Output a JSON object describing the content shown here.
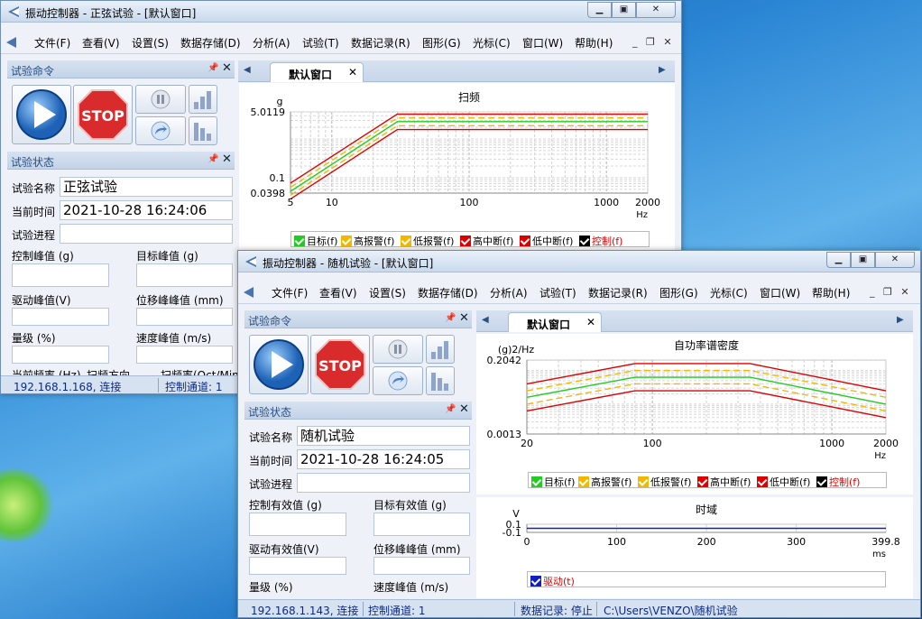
{
  "win1": {
    "title": "振动控制器 - 正弦试验 - [默认窗口]",
    "menu": [
      "文件(F)",
      "查看(V)",
      "设置(S)",
      "数据存储(D)",
      "分析(A)",
      "试验(T)",
      "数据记录(R)",
      "图形(G)",
      "光标(C)",
      "窗口(W)",
      "帮助(H)"
    ],
    "cmd_panel": "试验命令",
    "state_panel": "试验状态",
    "labels": {
      "name": "试验名称",
      "time": "当前时间",
      "progress": "试验进程",
      "ctrl_peak": "控制峰值 (g)",
      "target_peak": "目标峰值 (g)",
      "drive_peak": "驱动峰值(V)",
      "disp_peak": "位移峰峰值 (mm)",
      "level": "量级 (%)",
      "vel_peak": "速度峰值 (m/s)",
      "cut1": "当前频率 (Hz)",
      "cut2": "扫频方向",
      "cut3": "扫频率(Oct/Min)"
    },
    "values": {
      "name": "正弦试验",
      "time": "2021-10-28 16:24:06"
    },
    "tab": "默认窗口",
    "status": {
      "ip": "192.168.1.168, 连接",
      "channel": "控制通道: 1"
    },
    "stop_label": "STOP"
  },
  "win2": {
    "title": "振动控制器 - 随机试验 - [默认窗口]",
    "menu": [
      "文件(F)",
      "查看(V)",
      "设置(S)",
      "数据存储(D)",
      "分析(A)",
      "试验(T)",
      "数据记录(R)",
      "图形(G)",
      "光标(C)",
      "窗口(W)",
      "帮助(H)"
    ],
    "cmd_panel": "试验命令",
    "state_panel": "试验状态",
    "labels": {
      "name": "试验名称",
      "time": "当前时间",
      "progress": "试验进程",
      "ctrl_rms": "控制有效值 (g)",
      "target_rms": "目标有效值 (g)",
      "drive_rms": "驱动有效值(V)",
      "disp_peak": "位移峰峰值 (mm)",
      "level": "量级 (%)",
      "vel_peak": "速度峰值 (m/s)"
    },
    "values": {
      "name": "随机试验",
      "time": "2021-10-28 16:24:05"
    },
    "tab": "默认窗口",
    "status": {
      "ip": "192.168.1.143, 连接",
      "channel": "控制通道: 1",
      "record": "数据记录: 停止",
      "path": "C:\\Users\\VENZO\\随机试验"
    },
    "stop_label": "STOP"
  },
  "legend": {
    "target": "目标(f)",
    "hi_alarm": "高报警(f)",
    "lo_alarm": "低报警(f)",
    "hi_abort": "高中断(f)",
    "lo_abort": "低中断(f)",
    "control": "控制(f)",
    "drive": "驱动(t)"
  },
  "colors": {
    "green": "#22cc22",
    "amber": "#f2b800",
    "red": "#dd0000",
    "black": "#000000",
    "blue": "#1020c0"
  },
  "chart_data": [
    {
      "type": "line",
      "title": "扫频",
      "ylabel": "g",
      "xlabel": "Hz",
      "xscale": "log",
      "yscale": "log",
      "xlim": [
        5,
        2000
      ],
      "ylim": [
        0.0398,
        5.0119
      ],
      "xticks": [
        "5",
        "10",
        "100",
        "1000",
        "2000"
      ],
      "yticks": [
        "5.0119",
        "0.1",
        "0.0398"
      ],
      "series": [
        {
          "name": "高中断(f)",
          "x": [
            5,
            30,
            2000
          ],
          "y": [
            0.072,
            4.4,
            4.4
          ],
          "color": "#dd0000",
          "style": "solid"
        },
        {
          "name": "高报警(f)",
          "x": [
            5,
            30,
            2000
          ],
          "y": [
            0.056,
            3.5,
            3.5
          ],
          "color": "#f2b800",
          "style": "dashed"
        },
        {
          "name": "目标(f)",
          "x": [
            5,
            30,
            2000
          ],
          "y": [
            0.044,
            2.8,
            2.8
          ],
          "color": "#22cc22",
          "style": "solid"
        },
        {
          "name": "低报警(f)",
          "x": [
            5,
            30,
            2000
          ],
          "y": [
            0.035,
            2.2,
            2.2
          ],
          "color": "#f2b800",
          "style": "dashed"
        },
        {
          "name": "低中断(f)",
          "x": [
            5,
            30,
            2000
          ],
          "y": [
            0.028,
            1.75,
            1.75
          ],
          "color": "#dd0000",
          "style": "solid"
        }
      ]
    },
    {
      "type": "line",
      "title": "自功率谱密度",
      "ylabel": "(g)2/Hz",
      "xlabel": "Hz",
      "xscale": "log",
      "yscale": "log",
      "xlim": [
        20,
        2000
      ],
      "ylim": [
        0.0013,
        0.2042
      ],
      "xticks": [
        "20",
        "100",
        "1000",
        "2000"
      ],
      "yticks": [
        "0.2042",
        "0.0013"
      ],
      "series": [
        {
          "name": "高中断(f)",
          "x": [
            20,
            80,
            350,
            2000
          ],
          "y": [
            0.04,
            0.16,
            0.16,
            0.025
          ],
          "color": "#dd0000",
          "style": "solid"
        },
        {
          "name": "高报警(f)",
          "x": [
            20,
            80,
            350,
            2000
          ],
          "y": [
            0.025,
            0.1,
            0.1,
            0.016
          ],
          "color": "#f2b800",
          "style": "dashed"
        },
        {
          "name": "目标(f)",
          "x": [
            20,
            80,
            350,
            2000
          ],
          "y": [
            0.016,
            0.063,
            0.063,
            0.01
          ],
          "color": "#22cc22",
          "style": "solid"
        },
        {
          "name": "低报警(f)",
          "x": [
            20,
            80,
            350,
            2000
          ],
          "y": [
            0.01,
            0.04,
            0.04,
            0.0063
          ],
          "color": "#f2b800",
          "style": "dashed"
        },
        {
          "name": "低中断(f)",
          "x": [
            20,
            80,
            350,
            2000
          ],
          "y": [
            0.0063,
            0.025,
            0.025,
            0.004
          ],
          "color": "#dd0000",
          "style": "solid"
        }
      ]
    },
    {
      "type": "line",
      "title": "时域",
      "ylabel": "V",
      "xlabel": "ms",
      "xlim": [
        0,
        399.8
      ],
      "ylim": [
        -0.1,
        0.1
      ],
      "xticks": [
        "0",
        "100",
        "200",
        "300",
        "399.8"
      ],
      "yticks": [
        "0.1",
        "-0.1"
      ],
      "series": [
        {
          "name": "驱动(t)",
          "x": [
            0,
            399.8
          ],
          "y": [
            0,
            0
          ],
          "color": "#1020c0",
          "style": "solid"
        }
      ]
    }
  ]
}
